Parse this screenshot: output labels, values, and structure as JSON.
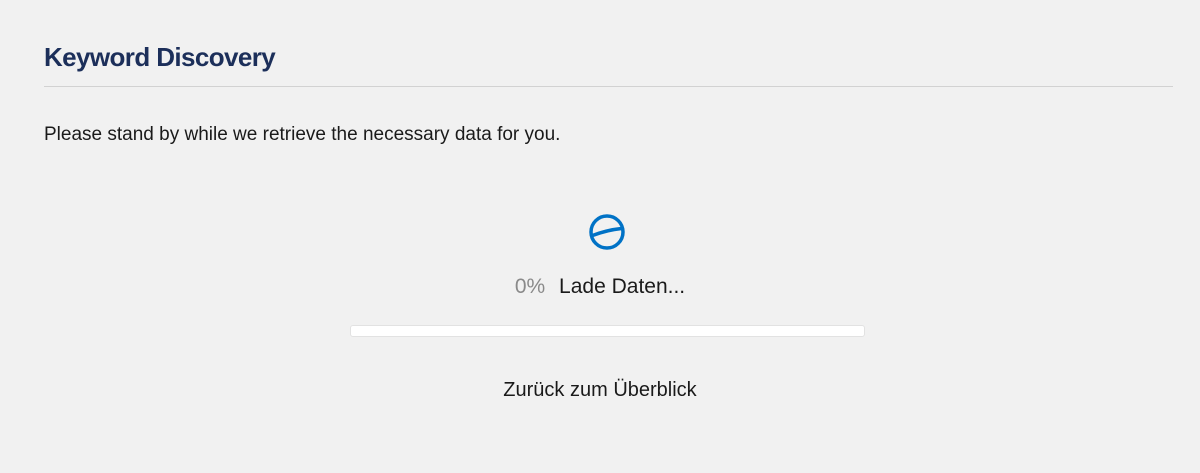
{
  "page": {
    "title": "Keyword Discovery",
    "message": "Please stand by while we retrieve the necessary data for you."
  },
  "loader": {
    "icon": "spinner-icon",
    "color": "#0072c6"
  },
  "progress": {
    "percent_label": "0%",
    "percent_value": 0,
    "status": "Lade Daten..."
  },
  "actions": {
    "back_label": "Zurück zum Überblick"
  },
  "colors": {
    "title": "#1c2f5a",
    "accent": "#0072c6",
    "background": "#f1f1f1"
  }
}
